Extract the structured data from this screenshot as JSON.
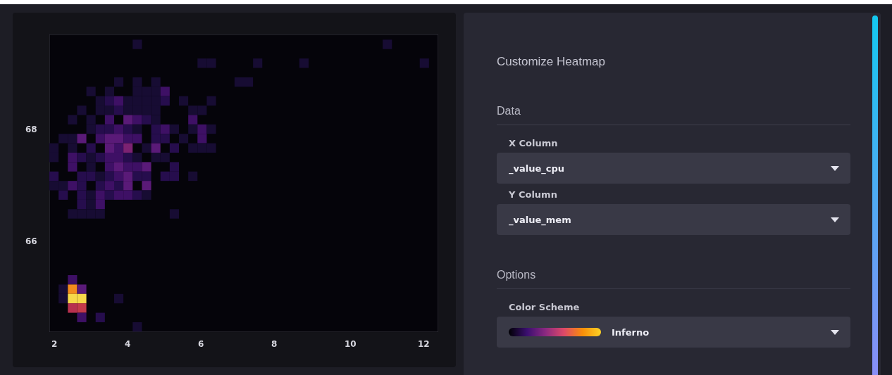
{
  "heatmap": {
    "x_ticks": [
      "2",
      "4",
      "6",
      "8",
      "10",
      "12"
    ],
    "y_ticks": [
      "68",
      "66"
    ]
  },
  "customize": {
    "title": "Customize Heatmap",
    "sections": [
      {
        "heading": "Data",
        "fields": [
          {
            "kind": "select",
            "label": "X Column",
            "value": "_value_cpu"
          },
          {
            "kind": "select",
            "label": "Y Column",
            "value": "_value_mem"
          }
        ]
      },
      {
        "heading": "Options",
        "fields": [
          {
            "kind": "color_scheme",
            "label": "Color Scheme",
            "value": "Inferno"
          }
        ]
      }
    ]
  }
}
